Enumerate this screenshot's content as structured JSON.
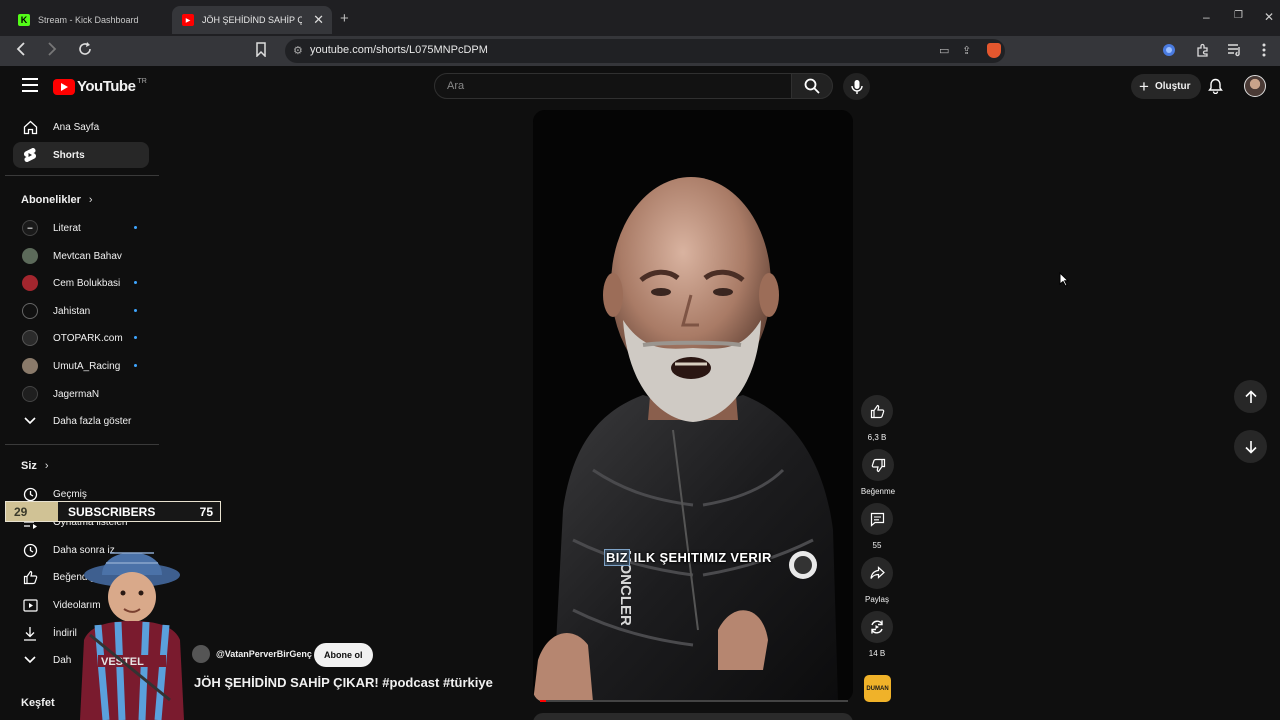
{
  "browser": {
    "tabs": [
      {
        "title": "Stream - Kick Dashboard",
        "active": false
      },
      {
        "title": "JÖH ŞEHİDİND SAHİP ÇIKAR!",
        "active": true
      }
    ],
    "url": "youtube.com/shorts/L075MNPcDPM"
  },
  "header": {
    "logo_text": "YouTube",
    "country_code": "TR",
    "search_placeholder": "Ara",
    "create_label": "Oluştur"
  },
  "sidebar": {
    "main": [
      {
        "label": "Ana Sayfa",
        "icon": "home-icon",
        "active": false
      },
      {
        "label": "Shorts",
        "icon": "shorts-icon",
        "active": true
      }
    ],
    "subscriptions_heading": "Abonelikler",
    "subscriptions": [
      {
        "label": "Literat",
        "new": true
      },
      {
        "label": "Mevtcan Bahav",
        "new": false
      },
      {
        "label": "Cem Bolukbasi",
        "new": true
      },
      {
        "label": "Jahistan",
        "new": true
      },
      {
        "label": "OTOPARK.com",
        "new": true
      },
      {
        "label": "UmutA_Racing",
        "new": true
      },
      {
        "label": "JagermaN",
        "new": false
      }
    ],
    "show_more": "Daha fazla göster",
    "you_heading": "Siz",
    "you_items": [
      {
        "label": "Geçmiş",
        "icon": "history-icon"
      },
      {
        "label": "Oynatma listeleri",
        "icon": "playlist-icon"
      },
      {
        "label": "Daha sonra iz",
        "icon": "watch-later-icon"
      },
      {
        "label": "Beğendiği",
        "icon": "like-icon"
      },
      {
        "label": "Videolarım",
        "icon": "video-icon"
      },
      {
        "label": "İndiril",
        "icon": "download-icon"
      },
      {
        "label": "Dah",
        "icon": "chevron-down-icon"
      }
    ],
    "explore_heading": "Keşfet"
  },
  "video": {
    "caption_highlight": "BIZ",
    "caption_rest": " ILK ŞEHITIMIZ VERIR",
    "channel": "@VatanPerverBirGenç",
    "subscribe_label": "Abone ol",
    "title": "JÖH ŞEHİDİND SAHİP ÇIKAR! #podcast #türkiye",
    "progress": 0.02
  },
  "actions": {
    "likes": "6,3 B",
    "dislike_label": "Beğenme",
    "comments": "55",
    "share_label": "Paylaş",
    "remix_count": "14 B",
    "music_label": "DUMAN"
  },
  "overlay": {
    "left_number": "29",
    "label": "SUBSCRIBERS",
    "right_number": "75"
  },
  "colors": {
    "background": "#0f0f0f",
    "brand_red": "#ff0000",
    "new_dot": "#3ea6ff",
    "counter_gold": "#d0c295"
  }
}
